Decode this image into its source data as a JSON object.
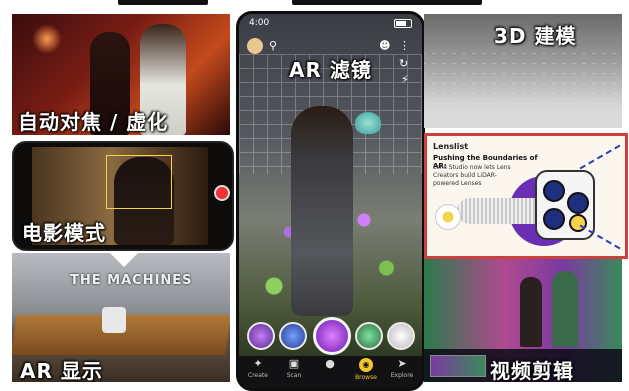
{
  "captions": {
    "autofocus": "自动对焦 / 虚化",
    "cinematic": "电影模式",
    "ar_display": "AR 显示",
    "ar_filter": "AR 滤镜",
    "modeling_3d": "3D 建模",
    "video_edit": "视频剪辑"
  },
  "scene_text": {
    "ar_board_title": "THE MACHINES"
  },
  "phone": {
    "time": "4:00",
    "nav": [
      {
        "label": "Create",
        "icon": "plus-icon"
      },
      {
        "label": "Scan",
        "icon": "scan-icon"
      },
      {
        "label": "",
        "icon": "capture-icon"
      },
      {
        "label": "Browse",
        "icon": "browse-icon",
        "active": true
      },
      {
        "label": "Explore",
        "icon": "explore-icon"
      }
    ]
  },
  "lens_card": {
    "brand": "Lenslist",
    "headline": "Pushing the Boundaries of AR:",
    "subtext": "Lens Studio now lets Lens Creators build LiDAR-powered Lenses"
  },
  "colors": {
    "card_border": "#c9423e",
    "active_nav": "#f2c82e",
    "card_purple": "#6a2fb5",
    "card_yellow": "#f4d24a"
  }
}
